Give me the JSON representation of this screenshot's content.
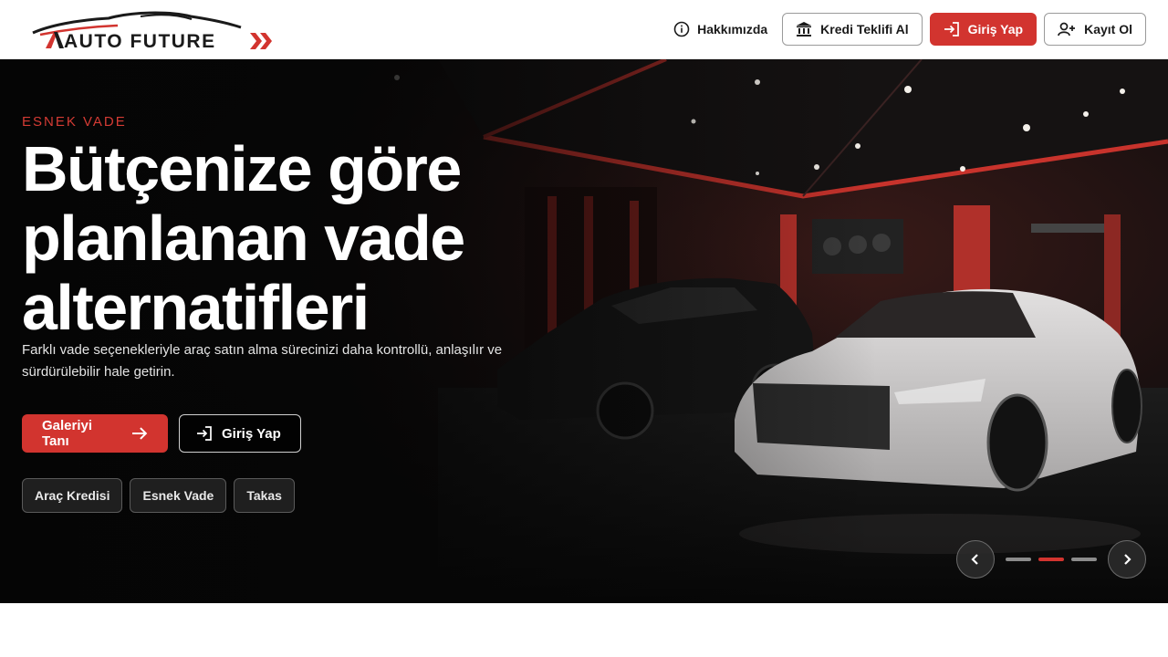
{
  "header": {
    "logo_text": "AUTO FUTURE",
    "nav": {
      "about_label": "Hakkımızda",
      "credit_offer_label": "Kredi Teklifi Al",
      "login_label": "Giriş Yap",
      "register_label": "Kayıt Ol"
    }
  },
  "hero": {
    "eyebrow": "ESNEK VADE",
    "headline": "Bütçenize göre planlanan vade alternatifleri",
    "subtext": "Farklı vade seçenekleriyle araç satın alma sürecinizi daha kontrollü, anlaşılır ve sürdürülebilir hale getirin.",
    "primary_cta": "Galeriyi Tanı",
    "secondary_cta": "Giriş Yap",
    "tags": [
      "Araç Kredisi",
      "Esnek Vade",
      "Takas"
    ],
    "slider": {
      "slide_count": 3,
      "active_slide": 2
    }
  },
  "colors": {
    "accent": "#d2342f",
    "header_bg": "#ffffff",
    "hero_bg": "#0b0b0b"
  },
  "icons": {
    "about": "info-icon",
    "credit": "bank-icon",
    "login": "login-icon",
    "register": "user-plus-icon",
    "primary_cta": "arrow-right-icon",
    "prev": "chevron-left-icon",
    "next": "chevron-right-icon"
  }
}
